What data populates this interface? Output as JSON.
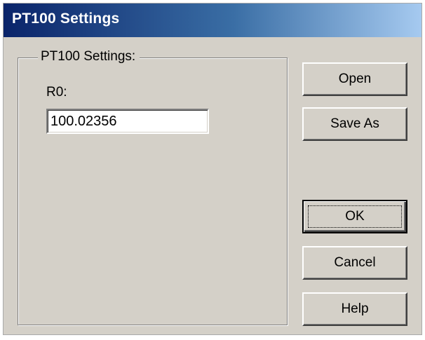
{
  "window": {
    "title": "PT100 Settings"
  },
  "group": {
    "label": "PT100 Settings:"
  },
  "r0": {
    "label": "R0:",
    "value": "100.02356"
  },
  "buttons": {
    "open": "Open",
    "save_as": "Save As",
    "ok": "OK",
    "cancel": "Cancel",
    "help": "Help"
  },
  "colors": {
    "titlebar_start": "#0a246a",
    "titlebar_end": "#a6caf0",
    "dialog_face": "#d4d0c8"
  }
}
